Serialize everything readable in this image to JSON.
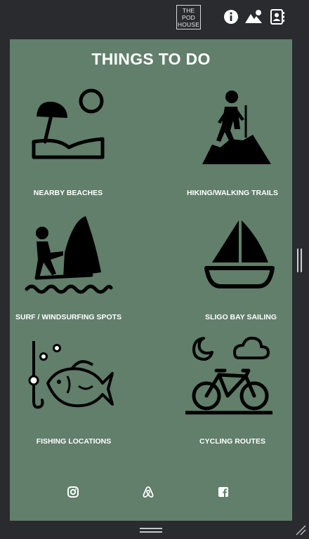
{
  "header": {
    "logo_lines": [
      "THE",
      "POD",
      "HOUSE"
    ],
    "icons": [
      "info-icon",
      "landscape-icon",
      "contacts-icon"
    ]
  },
  "main": {
    "title": "THINGS TO DO",
    "activities": [
      {
        "label": "NEARBY BEACHES",
        "icon": "beach-icon"
      },
      {
        "label": "HIKING/WALKING TRAILS",
        "icon": "hiker-icon"
      },
      {
        "label": "SURF / WINDSURFING SPOTS",
        "icon": "windsurfing-icon"
      },
      {
        "label": "SLIGO BAY SAILING",
        "icon": "sailboat-icon"
      },
      {
        "label": "FISHING LOCATIONS",
        "icon": "fishing-icon"
      },
      {
        "label": "CYCLING ROUTES",
        "icon": "bicycle-icon"
      }
    ]
  },
  "footer": {
    "social": [
      "instagram-icon",
      "airbnb-icon",
      "facebook-icon"
    ]
  },
  "colors": {
    "panel_bg": "#617f6b",
    "chrome_bg": "#2a2b2e",
    "text": "#ffffff"
  }
}
